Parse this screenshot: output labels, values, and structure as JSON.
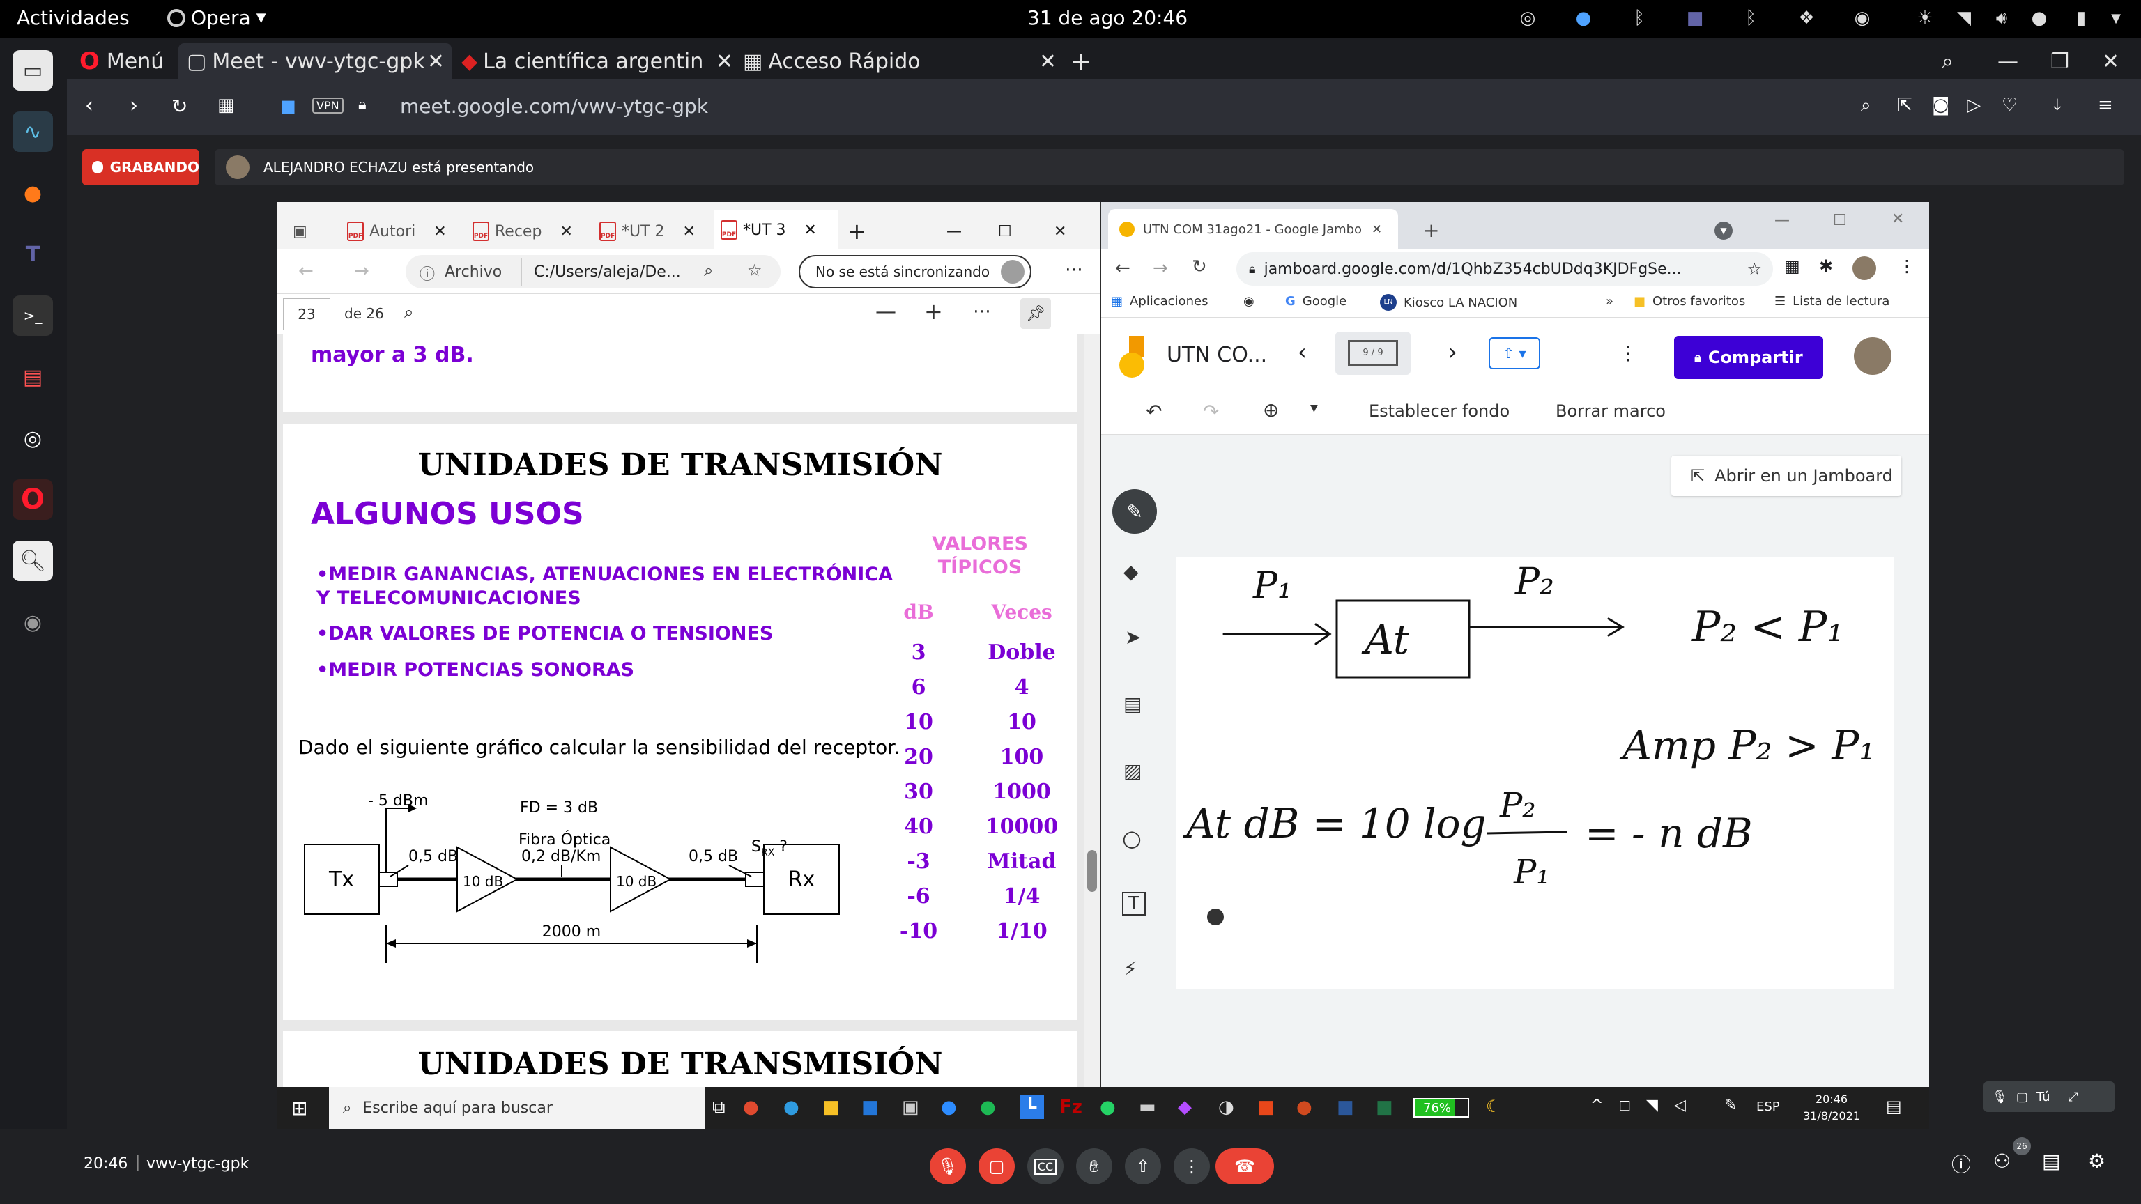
{
  "topbar": {
    "activities": "Actividades",
    "app": "Opera",
    "clock": "31 de ago  20:46"
  },
  "opera": {
    "menu": "Menú",
    "tabs": [
      {
        "label": "Meet - vwv-ytgc-gpk"
      },
      {
        "label": "La científica argentin"
      },
      {
        "label": "Acceso Rápido"
      }
    ],
    "vpn": "VPN",
    "url": "meet.google.com/vwv-ytgc-gpk"
  },
  "meet": {
    "recording": "GRABANDO",
    "presenting": "ALEJANDRO ECHAZU está presentando",
    "time": "20:46",
    "code": "vwv-ytgc-gpk",
    "self_label": "Tú",
    "participants": "26"
  },
  "edge": {
    "tabs": [
      "Autori",
      "Recep",
      "*UT 2",
      "*UT 3"
    ],
    "archivo": "Archivo",
    "path": "C:/Users/aleja/De...",
    "sync": "No se está sincronizando",
    "page": "23",
    "of": "de 26",
    "pdf": {
      "top_text": "mayor a 3 dB.",
      "title": "UNIDADES DE TRANSMISIÓN",
      "subtitle": "ALGUNOS USOS",
      "bullets": [
        "•MEDIR GANANCIAS, ATENUACIONES EN ELECTRÓNICA Y TELECOMUNICACIONES",
        "•DAR VALORES DE POTENCIA O TENSIONES",
        "•MEDIR POTENCIAS SONORAS"
      ],
      "tipicos": "VALORES TÍPICOS",
      "col_db": "dB",
      "col_veces": "Veces",
      "rows": [
        [
          "3",
          "Doble"
        ],
        [
          "6",
          "4"
        ],
        [
          "10",
          "10"
        ],
        [
          "20",
          "100"
        ],
        [
          "30",
          "1000"
        ],
        [
          "40",
          "10000"
        ],
        [
          "-3",
          "Mitad"
        ],
        [
          "-6",
          "1/4"
        ],
        [
          "-10",
          "1/10"
        ]
      ],
      "question": "Dado el siguiente gráfico calcular la sensibilidad del receptor.",
      "diagram": {
        "tx": "Tx",
        "rx": "Rx",
        "p_in": "- 5 dBm",
        "fd": "FD = 3 dB",
        "fibra": "Fibra Óptica",
        "fibra_loss": "0,2 dB/Km",
        "loss1": "0,5 dB",
        "loss2": "0,5 dB",
        "srx": "S",
        "srx_sub": "RX",
        "srx_q": " ?",
        "amp1": "10 dB",
        "amp2": "10 dB",
        "dist": "2000 m"
      },
      "next_title": "UNIDADES DE TRANSMISIÓN"
    }
  },
  "chrome": {
    "tab": "UTN COM 31ago21 - Google Jambo",
    "url": "jamboard.google.com/d/1QhbZ354cbUDdq3KJDFgSe...",
    "bookmarks": [
      "Aplicaciones",
      "Google",
      "Kiosco LA NACION",
      "Otros favoritos",
      "Lista de lectura"
    ],
    "jam_title": "UTN CO...",
    "frame": "9 / 9",
    "share": "Compartir",
    "set_bg": "Establecer fondo",
    "clear": "Borrar marco",
    "open_in": "Abrir en un Jamboard",
    "handwriting": {
      "p1": "P₁",
      "p2": "P₂",
      "at": "At",
      "ineq1": "P₂ < P₁",
      "amp": "Amp  P₂ > P₁",
      "formula_left": "At dB = 10 log",
      "formula_num": "P₂",
      "formula_den": "P₁",
      "formula_right": "= - n dB"
    }
  },
  "taskbar": {
    "search": "Escribe aquí para buscar",
    "battery": "76%",
    "lang": "ESP",
    "time": "20:46",
    "date": "31/8/2021"
  }
}
